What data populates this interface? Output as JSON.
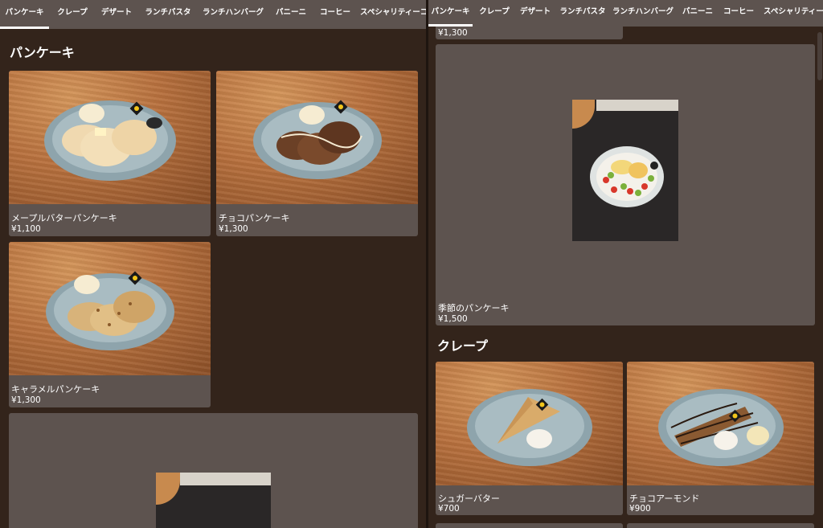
{
  "tabs": [
    "パンケーキ",
    "クレープ",
    "デザート",
    "ランチパスタ",
    "ランチハンバーグ",
    "パニーニ",
    "コーヒー",
    "スペシャリティーコ"
  ],
  "active_tab": "パンケーキ",
  "sections": {
    "pancake": "パンケーキ",
    "crepe": "クレープ"
  },
  "items": {
    "maple": {
      "name": "メープルバターパンケーキ",
      "price": "¥1,100"
    },
    "choco": {
      "name": "チョコパンケーキ",
      "price": "¥1,300"
    },
    "caramel": {
      "name": "キャラメルパンケーキ",
      "price": "¥1,300"
    },
    "seasonal": {
      "name": "季節のパンケーキ",
      "price": "¥1,500"
    },
    "sugar_butter": {
      "name": "シュガーバター",
      "price": "¥700"
    },
    "choco_almond": {
      "name": "チョコアーモンド",
      "price": "¥900"
    }
  },
  "colors": {
    "background": "#33241b",
    "tab_bar": "#5d534f",
    "card": "#5d534f",
    "text": "#ffffff"
  }
}
